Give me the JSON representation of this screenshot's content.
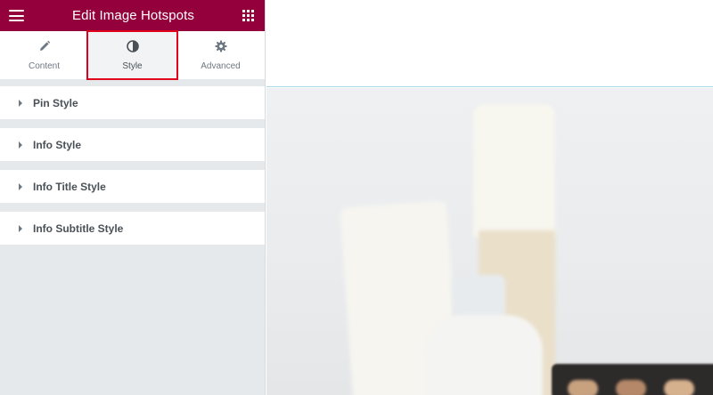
{
  "header": {
    "title": "Edit Image Hotspots"
  },
  "tabs": [
    {
      "label": "Content",
      "icon": "pencil-icon"
    },
    {
      "label": "Style",
      "icon": "half-circle-icon",
      "active": true
    },
    {
      "label": "Advanced",
      "icon": "gear-icon"
    }
  ],
  "sections": [
    {
      "label": "Pin Style"
    },
    {
      "label": "Info Style"
    },
    {
      "label": "Info Title Style"
    },
    {
      "label": "Info Subtitle Style"
    }
  ],
  "colors": {
    "header_bg": "#93003c",
    "highlight": "#e0001b",
    "panel_bg": "#e6e9ec"
  }
}
